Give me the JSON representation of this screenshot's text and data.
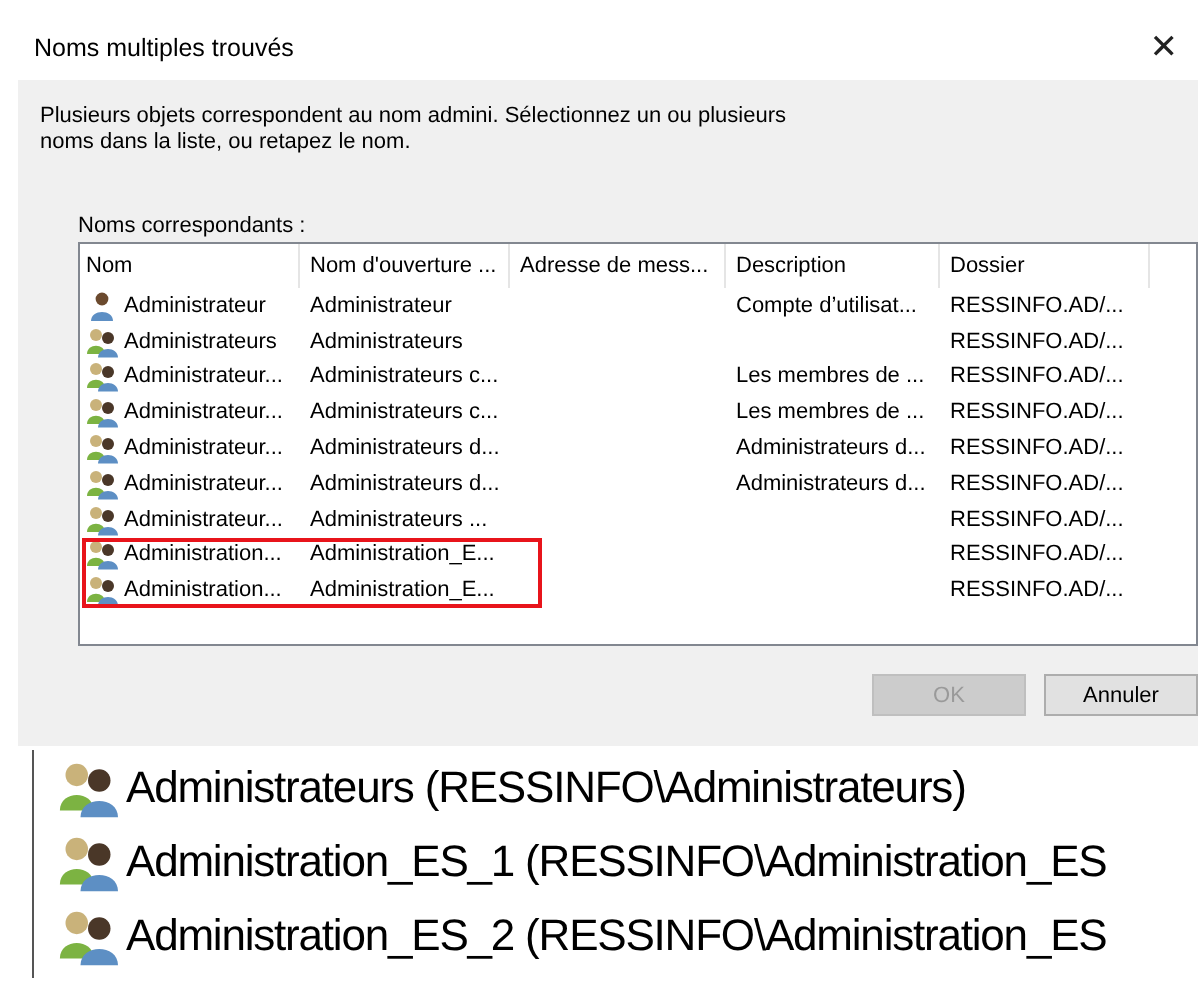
{
  "window": {
    "title": "Noms multiples trouvés",
    "close": "✕"
  },
  "message": "Plusieurs objets correspondent au nom admini. Sélectionnez un ou plusieurs noms dans la liste, ou retapez le nom.",
  "list_label": "Noms correspondants :",
  "table": {
    "columns": [
      "Nom",
      "Nom d'ouverture ...",
      "Adresse de mess...",
      "Description",
      "Dossier"
    ],
    "rows": [
      {
        "kind": "user",
        "highlighted": false,
        "cells": [
          "Administrateur",
          "Administrateur",
          "",
          "Compte d’utilisat...",
          "RESSINFO.AD/..."
        ]
      },
      {
        "kind": "group",
        "highlighted": false,
        "cells": [
          "Administrateurs",
          "Administrateurs",
          "",
          "",
          "RESSINFO.AD/..."
        ]
      },
      {
        "kind": "group",
        "highlighted": false,
        "cells": [
          "Administrateur...",
          "Administrateurs c...",
          "",
          "Les membres de ...",
          "RESSINFO.AD/..."
        ]
      },
      {
        "kind": "group",
        "highlighted": false,
        "cells": [
          "Administrateur...",
          "Administrateurs c...",
          "",
          "Les membres de ...",
          "RESSINFO.AD/..."
        ]
      },
      {
        "kind": "group",
        "highlighted": false,
        "cells": [
          "Administrateur...",
          "Administrateurs d...",
          "",
          "Administrateurs d...",
          "RESSINFO.AD/..."
        ]
      },
      {
        "kind": "group",
        "highlighted": false,
        "cells": [
          "Administrateur...",
          "Administrateurs d...",
          "",
          "Administrateurs d...",
          "RESSINFO.AD/..."
        ]
      },
      {
        "kind": "group",
        "highlighted": false,
        "cells": [
          "Administrateur...",
          "Administrateurs ...",
          "",
          "",
          "RESSINFO.AD/..."
        ]
      },
      {
        "kind": "group",
        "highlighted": true,
        "cells": [
          "Administration...",
          "Administration_E...",
          "",
          "",
          "RESSINFO.AD/..."
        ]
      },
      {
        "kind": "group",
        "highlighted": true,
        "cells": [
          "Administration...",
          "Administration_E...",
          "",
          "",
          "RESSINFO.AD/..."
        ]
      }
    ]
  },
  "buttons": [
    {
      "label": "OK",
      "disabled": true
    },
    {
      "label": "Annuler",
      "disabled": false
    }
  ],
  "zoom_detail": [
    {
      "kind": "group",
      "text": "Administrateurs (RESSINFO\\Administrateurs)"
    },
    {
      "kind": "group",
      "text": "Administration_ES_1 (RESSINFO\\Administration_ES"
    },
    {
      "kind": "group",
      "text": "Administration_ES_2 (RESSINFO\\Administration_ES"
    }
  ]
}
